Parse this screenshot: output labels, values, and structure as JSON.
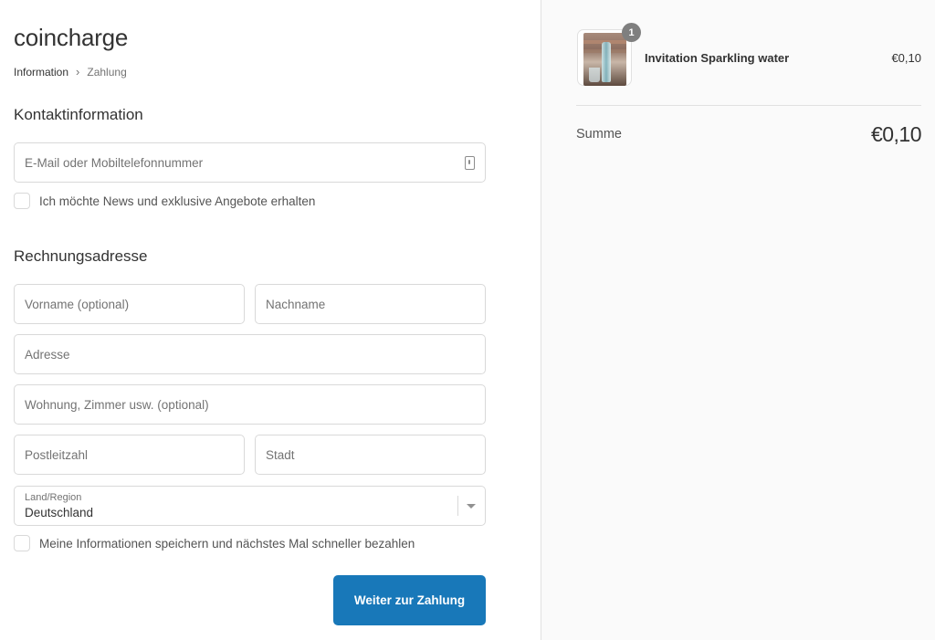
{
  "shop": {
    "name": "coincharge"
  },
  "breadcrumb": {
    "current": "Information",
    "separator": "›",
    "next": "Zahlung"
  },
  "contact": {
    "title": "Kontaktinformation",
    "email_placeholder": "E-Mail oder Mobiltelefonnummer",
    "email_icon": "contact-card-icon",
    "news_label": "Ich möchte News und exklusive Angebote erhalten"
  },
  "billing": {
    "title": "Rechnungsadresse",
    "first_name_placeholder": "Vorname (optional)",
    "last_name_placeholder": "Nachname",
    "address_placeholder": "Adresse",
    "address2_placeholder": "Wohnung, Zimmer usw. (optional)",
    "zip_placeholder": "Postleitzahl",
    "city_placeholder": "Stadt",
    "country_label": "Land/Region",
    "country_value": "Deutschland",
    "save_label": "Meine Informationen speichern und nächstes Mal schneller bezahlen"
  },
  "actions": {
    "continue_label": "Weiter zur Zahlung",
    "accent_color": "#1878b9"
  },
  "cart": {
    "item": {
      "name": "Invitation Sparkling water",
      "price": "€0,10",
      "quantity": "1"
    },
    "total_label": "Summe",
    "total_value": "€0,10"
  }
}
